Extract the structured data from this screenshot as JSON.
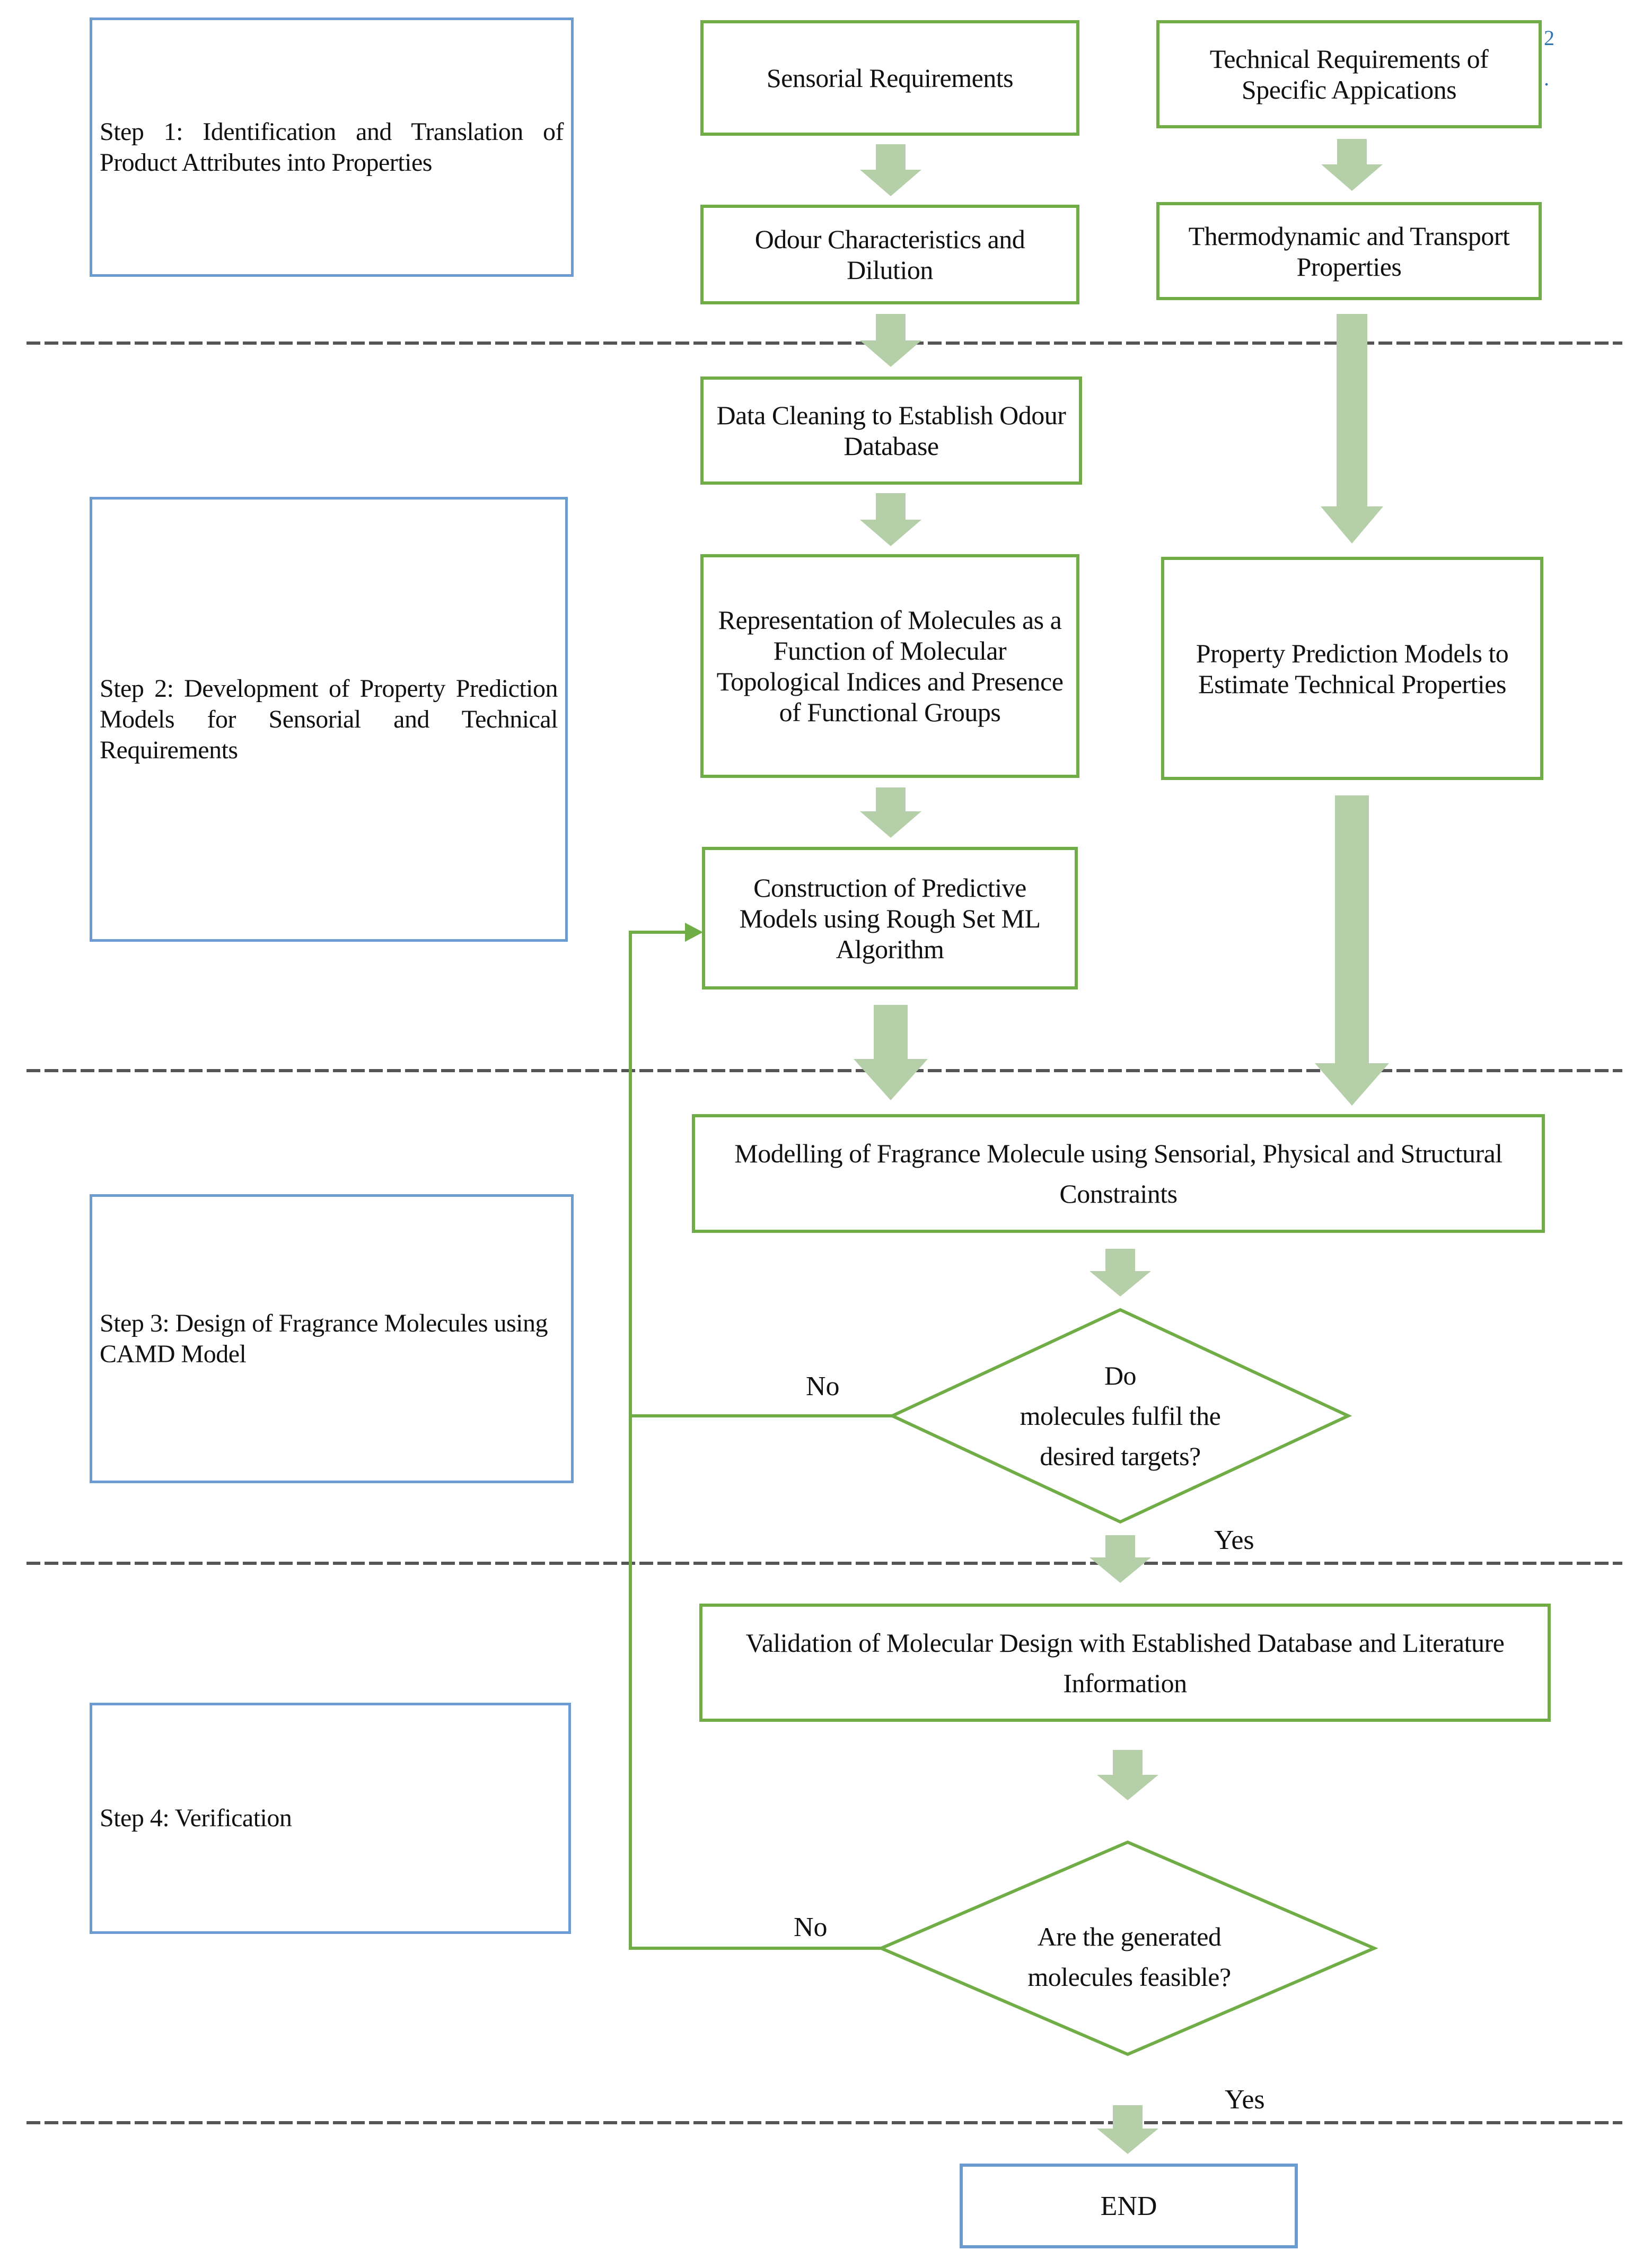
{
  "diagram": {
    "type": "flowchart",
    "colors": {
      "step_border": "#6A9BD1",
      "process_border": "#70AD47",
      "block_arrow_fill": "#B5D0A8",
      "connector": "#70AD47",
      "divider": "#555555"
    },
    "steps": [
      {
        "id": "step1",
        "label": "Step 1: Identification and Translation of Product Attributes into Properties"
      },
      {
        "id": "step2",
        "label": "Step 2: Development of Property Prediction Models for Sensorial and Technical Requirements"
      },
      {
        "id": "step3",
        "label": "Step 3: Design of Fragrance Molecules using CAMD Model"
      },
      {
        "id": "step4",
        "label": "Step 4: Verification"
      }
    ],
    "nodes": {
      "sensorial_requirements": "Sensorial Requirements",
      "technical_requirements": "Technical Requirements of Specific Appications",
      "odour_characteristics": "Odour Characteristics and Dilution",
      "thermodynamic_properties": "Thermodynamic and Transport Properties",
      "data_cleaning": "Data Cleaning to Establish Odour Database",
      "representation": "Representation of Molecules as a Function of Molecular Topological Indices and Presence of Functional Groups",
      "property_prediction": "Property Prediction Models to Estimate Technical Properties",
      "construction": "Construction of Predictive Models using Rough Set ML Algorithm",
      "modelling": "Modelling of Fragrance Molecule using Sensorial, Physical and Structural Constraints",
      "decision_targets": {
        "line1": "Do",
        "line2": "molecules fulfil the",
        "line3": "desired targets?"
      },
      "validation": "Validation of Molecular Design with Established Database and Literature Information",
      "decision_feasible": {
        "line1": "Are the generated",
        "line2": "molecules feasible?"
      },
      "end": "END"
    },
    "edge_labels": {
      "decision1_no": "No",
      "decision1_yes": "Yes",
      "decision2_no": "No",
      "decision2_yes": "Yes"
    },
    "edges": [
      {
        "from": "sensorial_requirements",
        "to": "odour_characteristics"
      },
      {
        "from": "technical_requirements",
        "to": "thermodynamic_properties"
      },
      {
        "from": "odour_characteristics",
        "to": "data_cleaning"
      },
      {
        "from": "thermodynamic_properties",
        "to": "property_prediction"
      },
      {
        "from": "data_cleaning",
        "to": "representation"
      },
      {
        "from": "representation",
        "to": "construction"
      },
      {
        "from": "construction",
        "to": "modelling"
      },
      {
        "from": "property_prediction",
        "to": "modelling"
      },
      {
        "from": "modelling",
        "to": "decision_targets"
      },
      {
        "from": "decision_targets",
        "to": "validation",
        "label": "Yes"
      },
      {
        "from": "decision_targets",
        "to": "construction",
        "label": "No"
      },
      {
        "from": "validation",
        "to": "decision_feasible"
      },
      {
        "from": "decision_feasible",
        "to": "end",
        "label": "Yes"
      },
      {
        "from": "decision_feasible",
        "to": "construction",
        "label": "No"
      }
    ],
    "stray_marks": {
      "a": "2",
      "b": "."
    }
  }
}
